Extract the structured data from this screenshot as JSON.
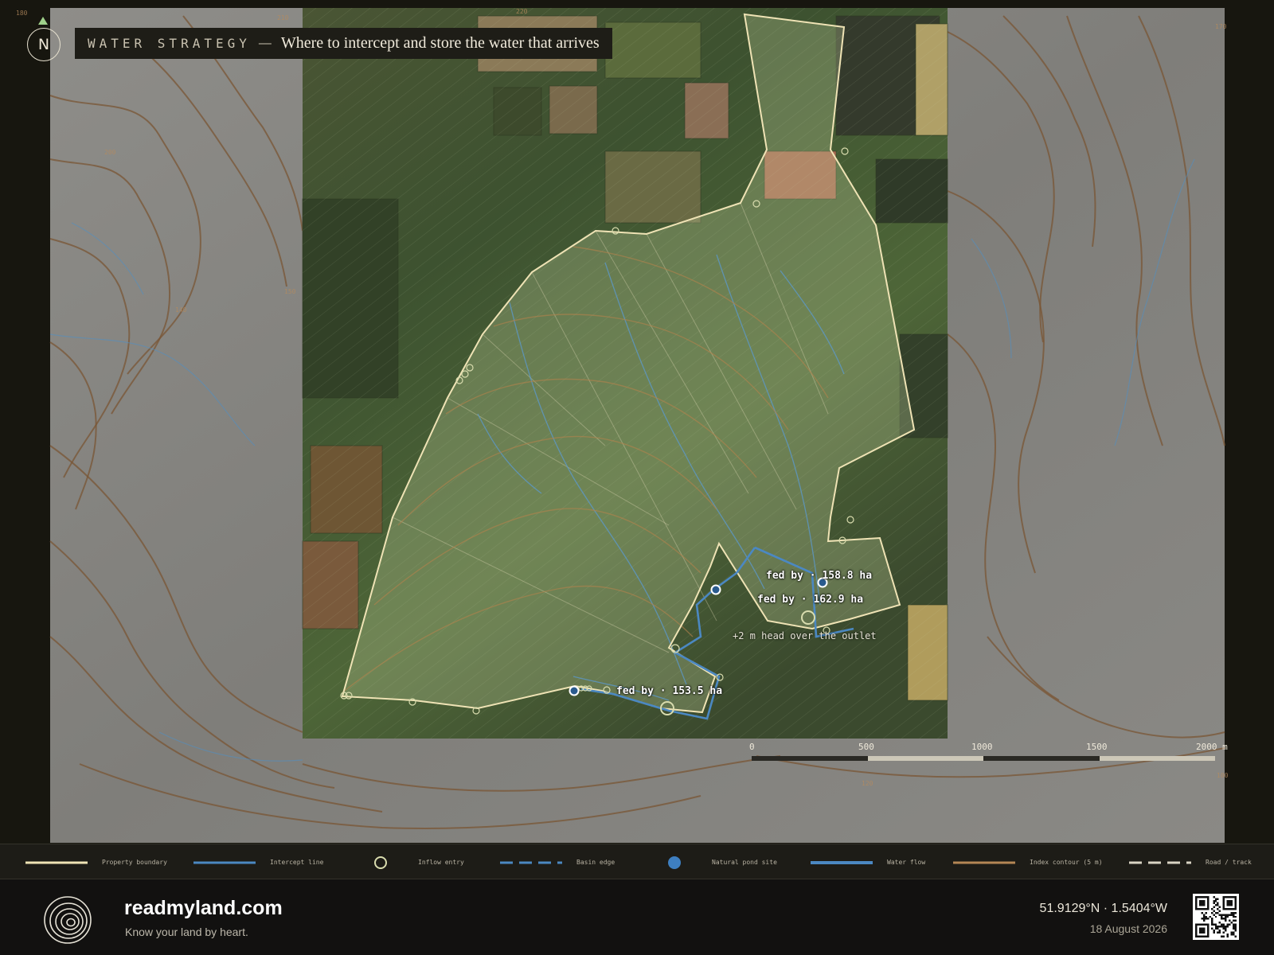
{
  "title": {
    "kicker": "WATER STRATEGY",
    "separator": "—",
    "subtitle": "Where to intercept and store the water that arrives"
  },
  "north": {
    "label": "N",
    "icon": "north-arrow-icon"
  },
  "contour_labels": [
    "180",
    "210",
    "220",
    "170",
    "200",
    "150",
    "140",
    "120",
    "100"
  ],
  "map_labels": {
    "fed_by_1": "fed by · 158.8 ha",
    "fed_by_2": "fed by · 162.9 ha",
    "head_note": "+2 m head over the outlet",
    "fed_by_3": "fed by · 153.5 ha"
  },
  "scale_bar": {
    "labels": [
      "0",
      "500",
      "1000",
      "1500",
      "2000 m"
    ]
  },
  "legend": {
    "items": [
      {
        "label": "Property boundary",
        "kind": "line",
        "color": "#efe3b5"
      },
      {
        "label": "Intercept line",
        "kind": "line",
        "color": "#4b88c2"
      },
      {
        "label": "Inflow entry",
        "kind": "ring",
        "color": "#d9dcae"
      },
      {
        "label": "Basin edge",
        "kind": "dash",
        "color": "#4b88c2"
      },
      {
        "label": "Natural pond site",
        "kind": "dot",
        "color": "#3e7fc1"
      },
      {
        "label": "Water flow",
        "kind": "line",
        "color": "#4b88c2"
      },
      {
        "label": "Index contour (5 m)",
        "kind": "line",
        "color": "#b48654"
      },
      {
        "label": "Road / track",
        "kind": "dash",
        "color": "#d9d4c4"
      }
    ]
  },
  "footer": {
    "brand": "readmyland.com",
    "tagline": "Know your land by heart.",
    "coordinates": "51.9129°N · 1.5404°W",
    "date": "18 August 2026",
    "logo_icon": "concentric-contour-logo-icon",
    "qr_icon": "qr-code-icon"
  },
  "colors": {
    "boundary": "#efe3b5",
    "water": "#4b88c2",
    "contour": "#8a5a32",
    "hillshade": "#8c8b87",
    "background": "#15140f"
  }
}
